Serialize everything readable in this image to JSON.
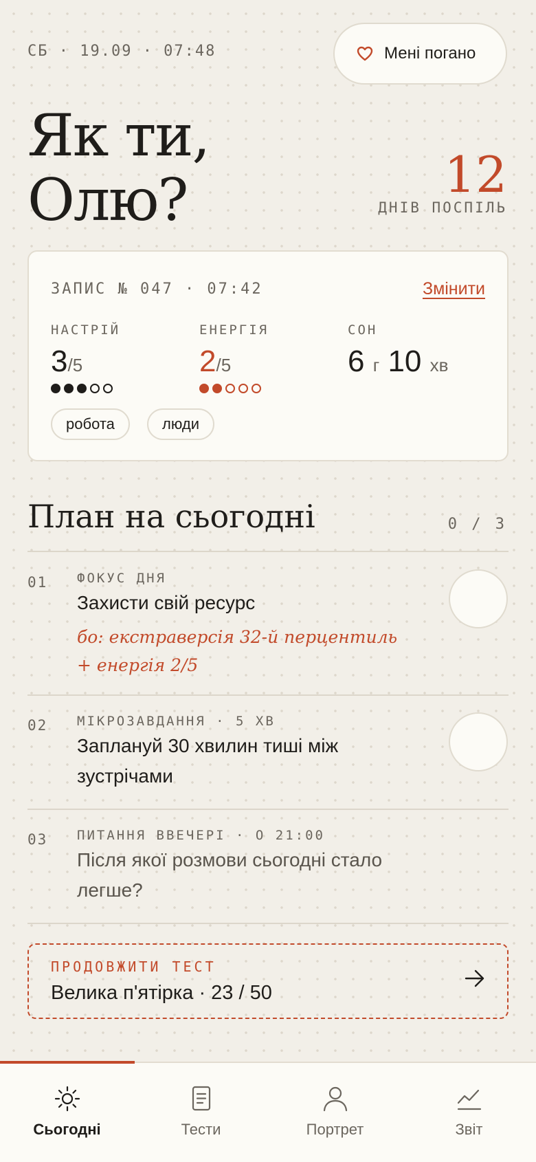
{
  "header": {
    "date": "СБ · 19.09 · 07:48",
    "bad_button_label": "Мені погано",
    "greeting_line1": "Як ти,",
    "greeting_line2": "Олю?",
    "streak_number": "12",
    "streak_label": "ДНІВ ПОСПІЛЬ"
  },
  "checkin": {
    "entry_label": "ЗАПИС № 047 · 07:42",
    "edit_label": "Змінити",
    "mood": {
      "label": "НАСТРІЙ",
      "value": "3",
      "max": "/5",
      "filled": 3,
      "total": 5
    },
    "energy": {
      "label": "ЕНЕРГІЯ",
      "value": "2",
      "max": "/5",
      "filled": 2,
      "total": 5
    },
    "sleep": {
      "label": "СОН",
      "hours": "6",
      "hours_unit": "г",
      "minutes": "10",
      "minutes_unit": "хв"
    },
    "tags": [
      "робота",
      "люди"
    ]
  },
  "plan": {
    "title": "План на сьогодні",
    "progress": "0 / 3",
    "items": [
      {
        "number": "01",
        "kicker": "ФОКУС ДНЯ",
        "title": "Захисти свій ресурс",
        "reason": "бо: екстраверсія 32-й перцентиль + енергія 2/5"
      },
      {
        "number": "02",
        "kicker": "МІКРОЗАВДАННЯ · 5 ХВ",
        "title": "Заплануй 30 хвилин тиші між зустрічами"
      },
      {
        "number": "03",
        "kicker": "ПИТАННЯ ВВЕЧЕРІ · О 21:00",
        "title": "Після якої розмови сьогодні стало легше?"
      }
    ]
  },
  "continue_test": {
    "kicker": "ПРОДОВЖИТИ ТЕСТ",
    "title": "Велика п'ятірка · 23 / 50"
  },
  "nav": {
    "tabs": [
      {
        "label": "Сьогодні",
        "icon": "sun-icon",
        "active": true
      },
      {
        "label": "Тести",
        "icon": "document-icon",
        "active": false
      },
      {
        "label": "Портрет",
        "icon": "person-icon",
        "active": false
      },
      {
        "label": "Звіт",
        "icon": "chart-icon",
        "active": false
      }
    ]
  },
  "colors": {
    "accent": "#c24a2a",
    "background": "#f2efe8",
    "card": "#fcfbf6",
    "text": "#1f1d1a",
    "muted": "#6b665e"
  }
}
